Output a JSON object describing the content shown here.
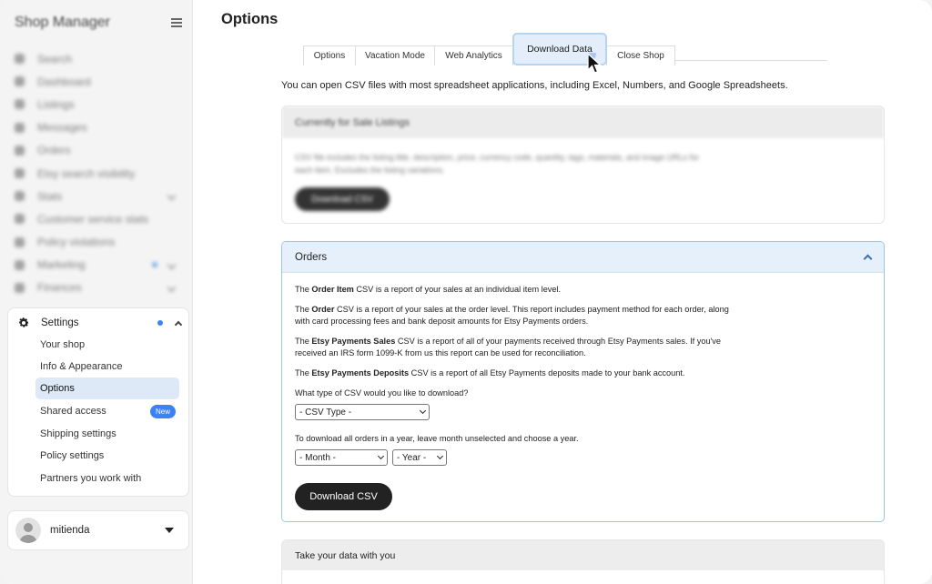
{
  "sidebar": {
    "title": "Shop Manager",
    "nav_items": [
      {
        "label": "Search",
        "icon": "search-icon"
      },
      {
        "label": "Dashboard",
        "icon": "home-icon"
      },
      {
        "label": "Listings",
        "icon": "tag-icon"
      },
      {
        "label": "Messages",
        "icon": "mail-icon"
      },
      {
        "label": "Orders",
        "icon": "clipboard-icon"
      },
      {
        "label": "Etsy search visibility",
        "icon": "eye-icon"
      },
      {
        "label": "Stats",
        "icon": "bar-chart-icon"
      },
      {
        "label": "Customer service stats",
        "icon": "headset-icon"
      },
      {
        "label": "Policy violations",
        "icon": "flag-icon"
      },
      {
        "label": "Marketing",
        "icon": "megaphone-icon"
      },
      {
        "label": "Finances",
        "icon": "bank-icon"
      }
    ],
    "settings": {
      "label": "Settings",
      "items": [
        {
          "label": "Your shop"
        },
        {
          "label": "Info & Appearance"
        },
        {
          "label": "Options"
        },
        {
          "label": "Shared access",
          "badge": "New"
        },
        {
          "label": "Shipping settings"
        },
        {
          "label": "Policy settings"
        },
        {
          "label": "Partners you work with"
        }
      ]
    },
    "user": {
      "name": "mitienda"
    }
  },
  "main": {
    "title": "Options",
    "tabs": [
      {
        "label": "Options"
      },
      {
        "label": "Vacation Mode"
      },
      {
        "label": "Web Analytics"
      },
      {
        "label": "Download Data"
      },
      {
        "label": "Close Shop"
      }
    ],
    "intro": "You can open CSV files with most spreadsheet applications, including Excel, Numbers, and Google Spreadsheets.",
    "listings_card": {
      "title": "Currently for Sale Listings",
      "text": "CSV file includes the listing title, description, price, currency code, quantity, tags, materials, and image URLs for each item. Excludes the listing variations.",
      "button": "Download CSV"
    },
    "orders_card": {
      "title": "Orders",
      "p1": {
        "pre": "The ",
        "bold": "Order Item",
        "post": " CSV is a report of your sales at an individual item level."
      },
      "p2": {
        "pre": "The ",
        "bold": "Order",
        "post": " CSV is a report of your sales at the order level. This report includes payment method for each order, along with card processing fees and bank deposit amounts for Etsy Payments orders."
      },
      "p3": {
        "pre": "The ",
        "bold": "Etsy Payments Sales",
        "post": " CSV is a report of all of your payments received through Etsy Payments sales. If you've received an IRS form 1099-K from us this report can be used for reconciliation."
      },
      "p4": {
        "pre": "The ",
        "bold": "Etsy Payments Deposits",
        "post": " CSV is a report of all Etsy Payments deposits made to your bank account."
      },
      "question": "What type of CSV would you like to download?",
      "csv_type": "- CSV Type -",
      "year_instruction": "To download all orders in a year, leave month unselected and choose a year.",
      "month": "- Month -",
      "year": "- Year -",
      "button": "Download CSV"
    },
    "take_card": {
      "title": "Take your data with you"
    }
  },
  "colors": {
    "accent": "#3b82f6",
    "tab_active_bg": "#e3eefa",
    "button_dark": "#222222"
  }
}
